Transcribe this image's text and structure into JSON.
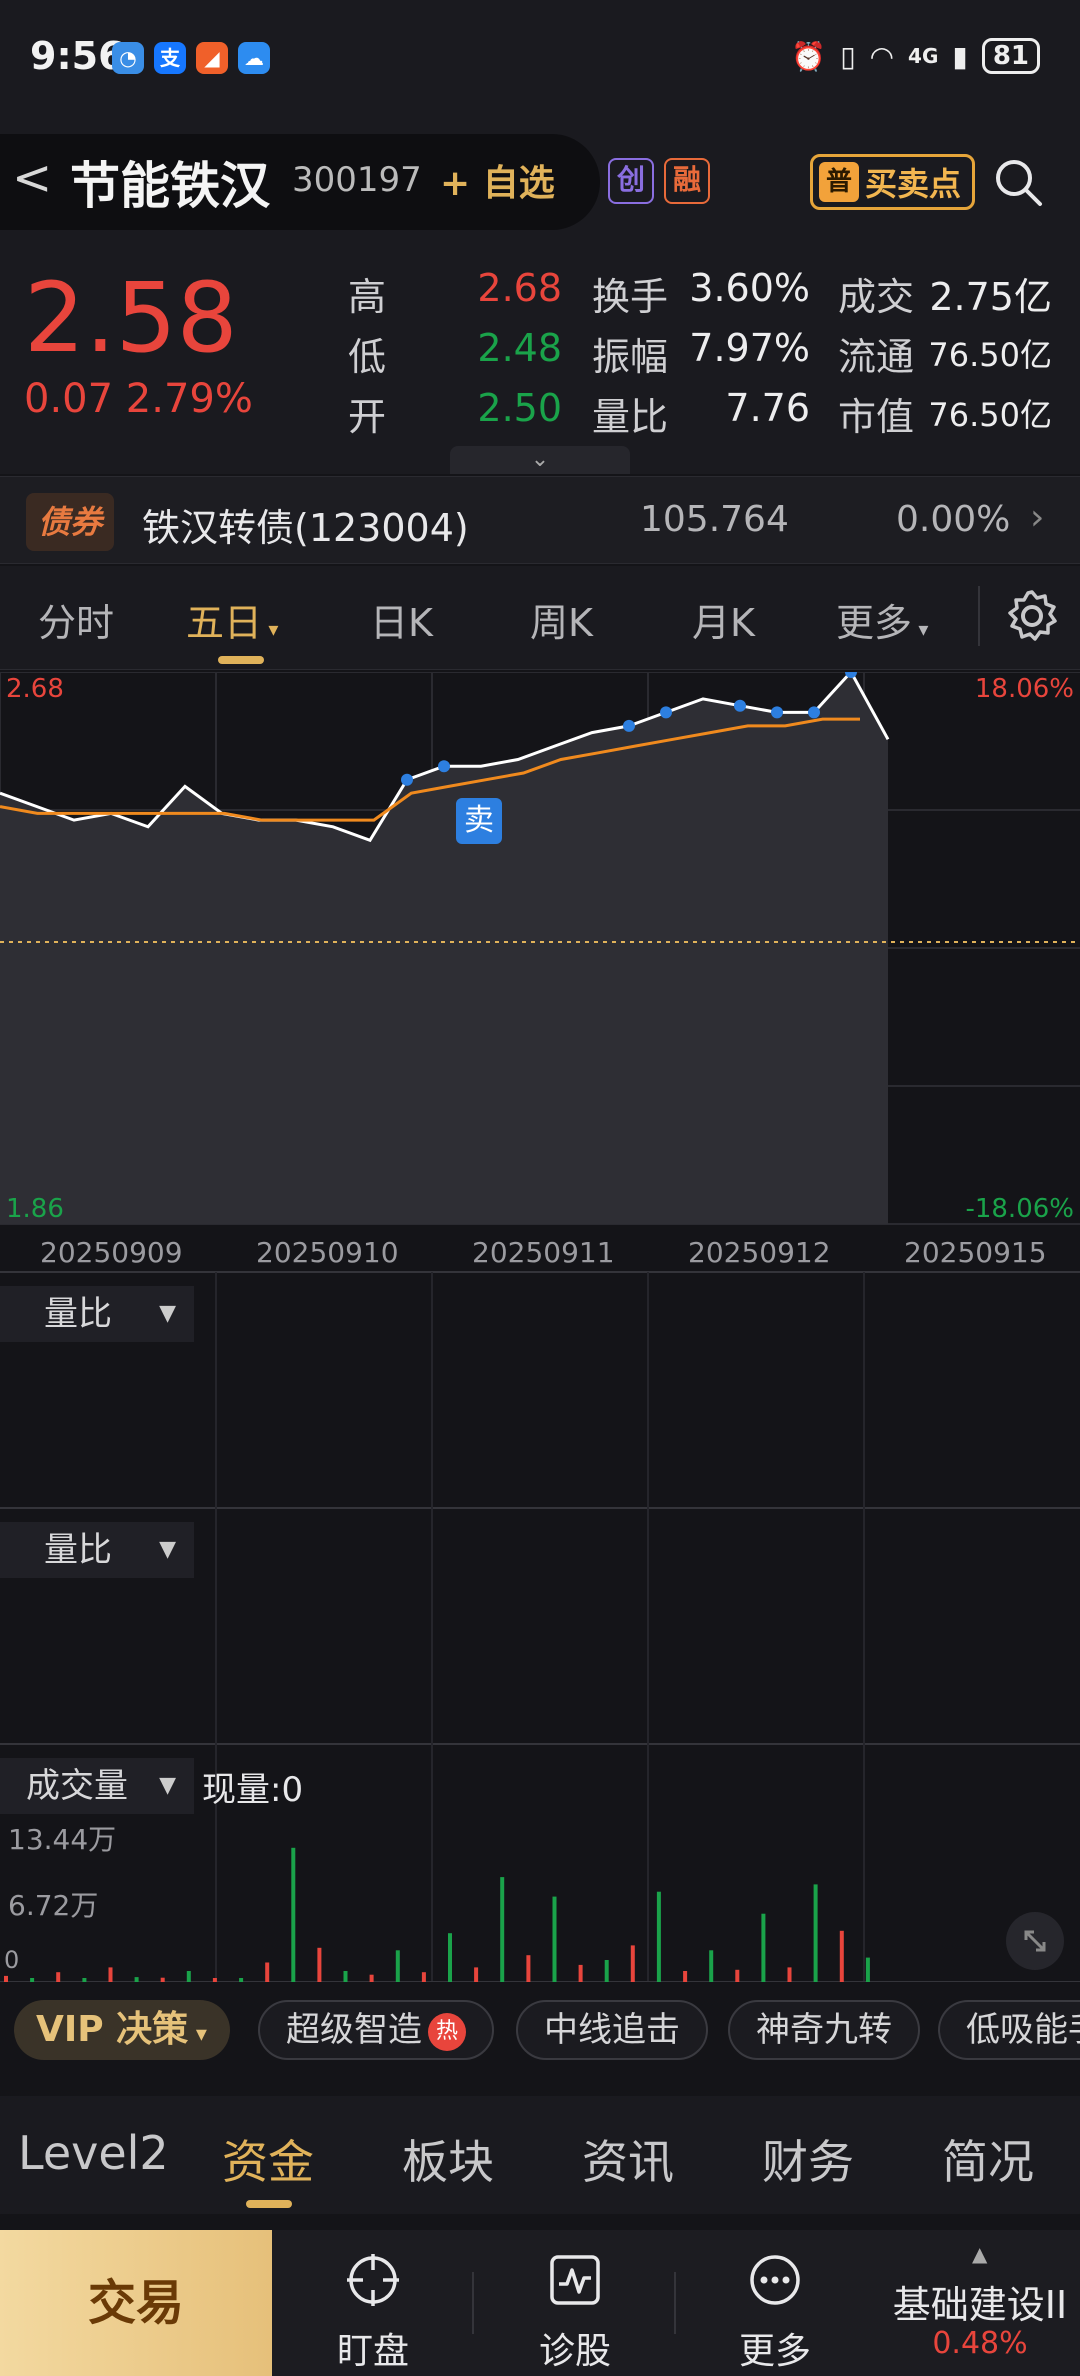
{
  "status_bar": {
    "time": "9:56",
    "battery": "81",
    "network": "4G"
  },
  "header": {
    "back": "<",
    "name": "节能铁汉",
    "code": "300197",
    "add_watchlist": "+ 自选",
    "badge_chuang": "创",
    "badge_rong": "融",
    "buysell_tag": "普",
    "buysell_label": "买卖点"
  },
  "quote": {
    "price": "2.58",
    "change": "0.07",
    "change_pct": "2.79%",
    "rows": [
      {
        "l1": "高",
        "v1": "2.68",
        "l2": "换手",
        "v2": "3.60%",
        "l3": "成交",
        "v3": "2.75亿"
      },
      {
        "l1": "低",
        "v1": "2.48",
        "l2": "振幅",
        "v2": "7.97%",
        "l3": "流通",
        "v3": "76.50亿"
      },
      {
        "l1": "开",
        "v1": "2.50",
        "l2": "量比",
        "v2": "7.76",
        "l3": "市值",
        "v3": "76.50亿"
      }
    ],
    "colors": {
      "up": "#e8453c",
      "down": "#1aa34a"
    }
  },
  "bond": {
    "tag": "债券",
    "name": "铁汉转债(123004)",
    "price": "105.764",
    "pct": "0.00%"
  },
  "chart_tabs": {
    "items": [
      "分时",
      "五日",
      "日K",
      "周K",
      "月K",
      "更多"
    ],
    "active": "五日"
  },
  "chart_data": {
    "type": "line",
    "x": [
      "20250909",
      "20250910",
      "20250911",
      "20250912",
      "20250915"
    ],
    "series": [
      {
        "values": [
          2.5,
          2.48,
          2.46,
          2.47,
          2.45,
          2.51,
          2.47,
          2.46,
          2.46,
          2.45,
          2.43,
          2.52,
          2.54,
          2.54,
          2.55,
          2.57,
          2.59,
          2.6,
          2.62,
          2.64,
          2.63,
          2.62,
          2.62,
          2.68,
          2.58
        ]
      },
      {
        "values": [
          2.48,
          2.47,
          2.47,
          2.47,
          2.47,
          2.47,
          2.47,
          2.46,
          2.46,
          2.46,
          2.46,
          2.5,
          2.51,
          2.52,
          2.53,
          2.55,
          2.56,
          2.57,
          2.58,
          2.59,
          2.6,
          2.6,
          2.61,
          2.61
        ]
      }
    ],
    "ylim": [
      1.86,
      2.68
    ],
    "y_left_top": "2.68",
    "y_left_bottom": "1.86",
    "y_right_top": "18.06%",
    "y_right_bottom": "-18.06%",
    "marker_label": "卖",
    "colors": {
      "price": "#ffffff",
      "avg": "#f08a1e",
      "area": "#2e2e34"
    },
    "volume": {
      "ylim": [
        0,
        134400
      ],
      "ticks": [
        "13.44万",
        "6.72万",
        "0"
      ],
      "values": [
        5000,
        3000,
        8000,
        2500,
        12000,
        4000,
        3500,
        9000,
        3000,
        2800,
        16000,
        110000,
        28000,
        9000,
        6000,
        26000,
        8000,
        40000,
        12000,
        86000,
        22000,
        70000,
        14000,
        18000,
        30000,
        74000,
        9000,
        26000,
        10000,
        56000,
        12000,
        80000,
        42000,
        20000
      ]
    }
  },
  "panels": {
    "p1_label": "量比",
    "p2_label": "量比",
    "vol_label": "成交量",
    "vol_current": "现量:0"
  },
  "strategy_strip": {
    "vip": "VIP 决策",
    "items": [
      "超级智造",
      "中线追击",
      "神奇九转",
      "低吸能手"
    ],
    "hot": "热"
  },
  "bottom_tabs": {
    "items": [
      "Level2",
      "资金",
      "板块",
      "资讯",
      "财务",
      "简况"
    ],
    "active": "资金"
  },
  "bottom_bar": {
    "trade": "交易",
    "items": [
      "盯盘",
      "诊股",
      "更多"
    ],
    "sector": "基础建设II",
    "sector_pct": "0.48%"
  }
}
